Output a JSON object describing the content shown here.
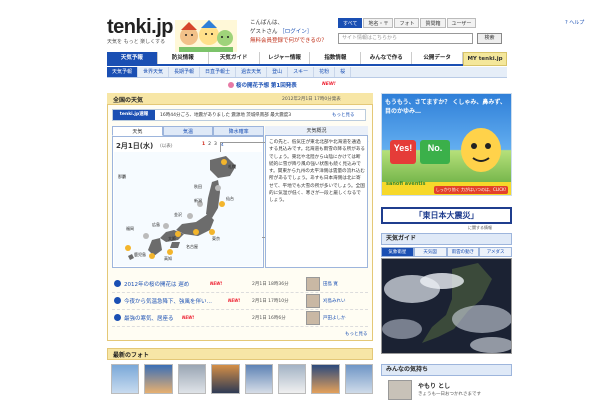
{
  "header": {
    "logo": "tenki.jp",
    "tagline": "天気を もっと 楽しくする",
    "greeting": "こんばんは、",
    "guest_prefix": "ゲストさん",
    "login": "［ログイン］",
    "register": "無料会員登録で何ができるの？",
    "search_tabs": [
      "すべて",
      "地名・〒",
      "フォト",
      "質問箱",
      "ユーザー"
    ],
    "help": "ヘルプ",
    "search_placeholder": "サイト情報はこちらから",
    "search_button": "検索"
  },
  "nav": {
    "items": [
      "天気予報",
      "防災情報",
      "天気ガイド",
      "レジャー情報",
      "指数情報",
      "みんなで作る",
      "公開データ"
    ],
    "my": "MY tenki.jp"
  },
  "subnav": {
    "items": [
      "天気予報",
      "世界天気",
      "長期予報",
      "日直予報士",
      "過去天気",
      "登山",
      "スキー",
      "花粉",
      "桜"
    ]
  },
  "sakura": {
    "text": "桜の開花予想 第1回発表",
    "new": "NEW!"
  },
  "main": {
    "title": "全国の天気",
    "date": "2012年2月1日 17時0分発表",
    "quake_badge": "tenki.jp速報",
    "quake_text": "16時44分ごろ、地震がありました 震源地 茨城県南部 最大震度3",
    "quake_more": "もっと見る",
    "tabs": [
      "天気",
      "気温",
      "降水確率"
    ],
    "map_date": "2月1日(水)",
    "map_sub": "(以表)",
    "days": [
      "1",
      "2",
      "3",
      "4",
      "5",
      "6",
      "7"
    ],
    "cities": [
      "札幌",
      "秋田",
      "仙台",
      "新潟",
      "金沢",
      "名古屋",
      "東京",
      "大阪",
      "広島",
      "高知",
      "福岡",
      "鹿児島",
      "那覇"
    ],
    "summary_title": "天気概況",
    "summary_text": "この先と、低気圧が東北北部や北海道を通過する見込みです。北海道も雨雪の降る所があるでしょう。東北や北陸から山陰にかけては断続的に雪が降り風の強い状態も続く見込みです。関東から九州の太平洋側は雲量の流れ込む所があるでしょう。あすも日本海側は北に寄せて、平地でも大雪の所が多いでしょう。全国的に気温が低く、寒さが一段と厳しくなるでしょう。"
  },
  "news": [
    {
      "text": "2012年の桜の開花は 遅め",
      "new": "NEW!",
      "time": "2月1日 18時36分",
      "author": "田島 寛"
    },
    {
      "text": "今夜から気温急降下、強風を伴い…",
      "new": "NEW!",
      "time": "2月1日 17時10分",
      "author": "刈島みれい"
    },
    {
      "text": "最強の寒気、居座る",
      "new": "NEW!",
      "time": "2月1日 16時6分",
      "author": "戸田よしか"
    }
  ],
  "news_more": "もっと見る",
  "photos": {
    "title": "最新のフォト"
  },
  "ad": {
    "caption": "もうもう、さてますか？ くしゃみ、鼻みず、目のかゆみ…",
    "yes": "Yes!",
    "no": "No.",
    "brand": "sanofi aventis",
    "button": "しっかり効く 力がはいつのは、CLICK!"
  },
  "quake_banner": {
    "title": "「東日本大震災」",
    "sub": "に関する情報"
  },
  "right_guide": {
    "title": "天気ガイド",
    "tabs": [
      "気象衛星",
      "天気図",
      "雨雲の動き",
      "アメダス"
    ]
  },
  "minna": {
    "title": "みんなの気持ち",
    "name": "やもり とし",
    "sub": "きょうも一日おつかれさまです"
  },
  "colors": {
    "brand_blue": "#1a4fb3",
    "panel_yellow": "#f7e6a6",
    "alert_red": "#e22222"
  }
}
